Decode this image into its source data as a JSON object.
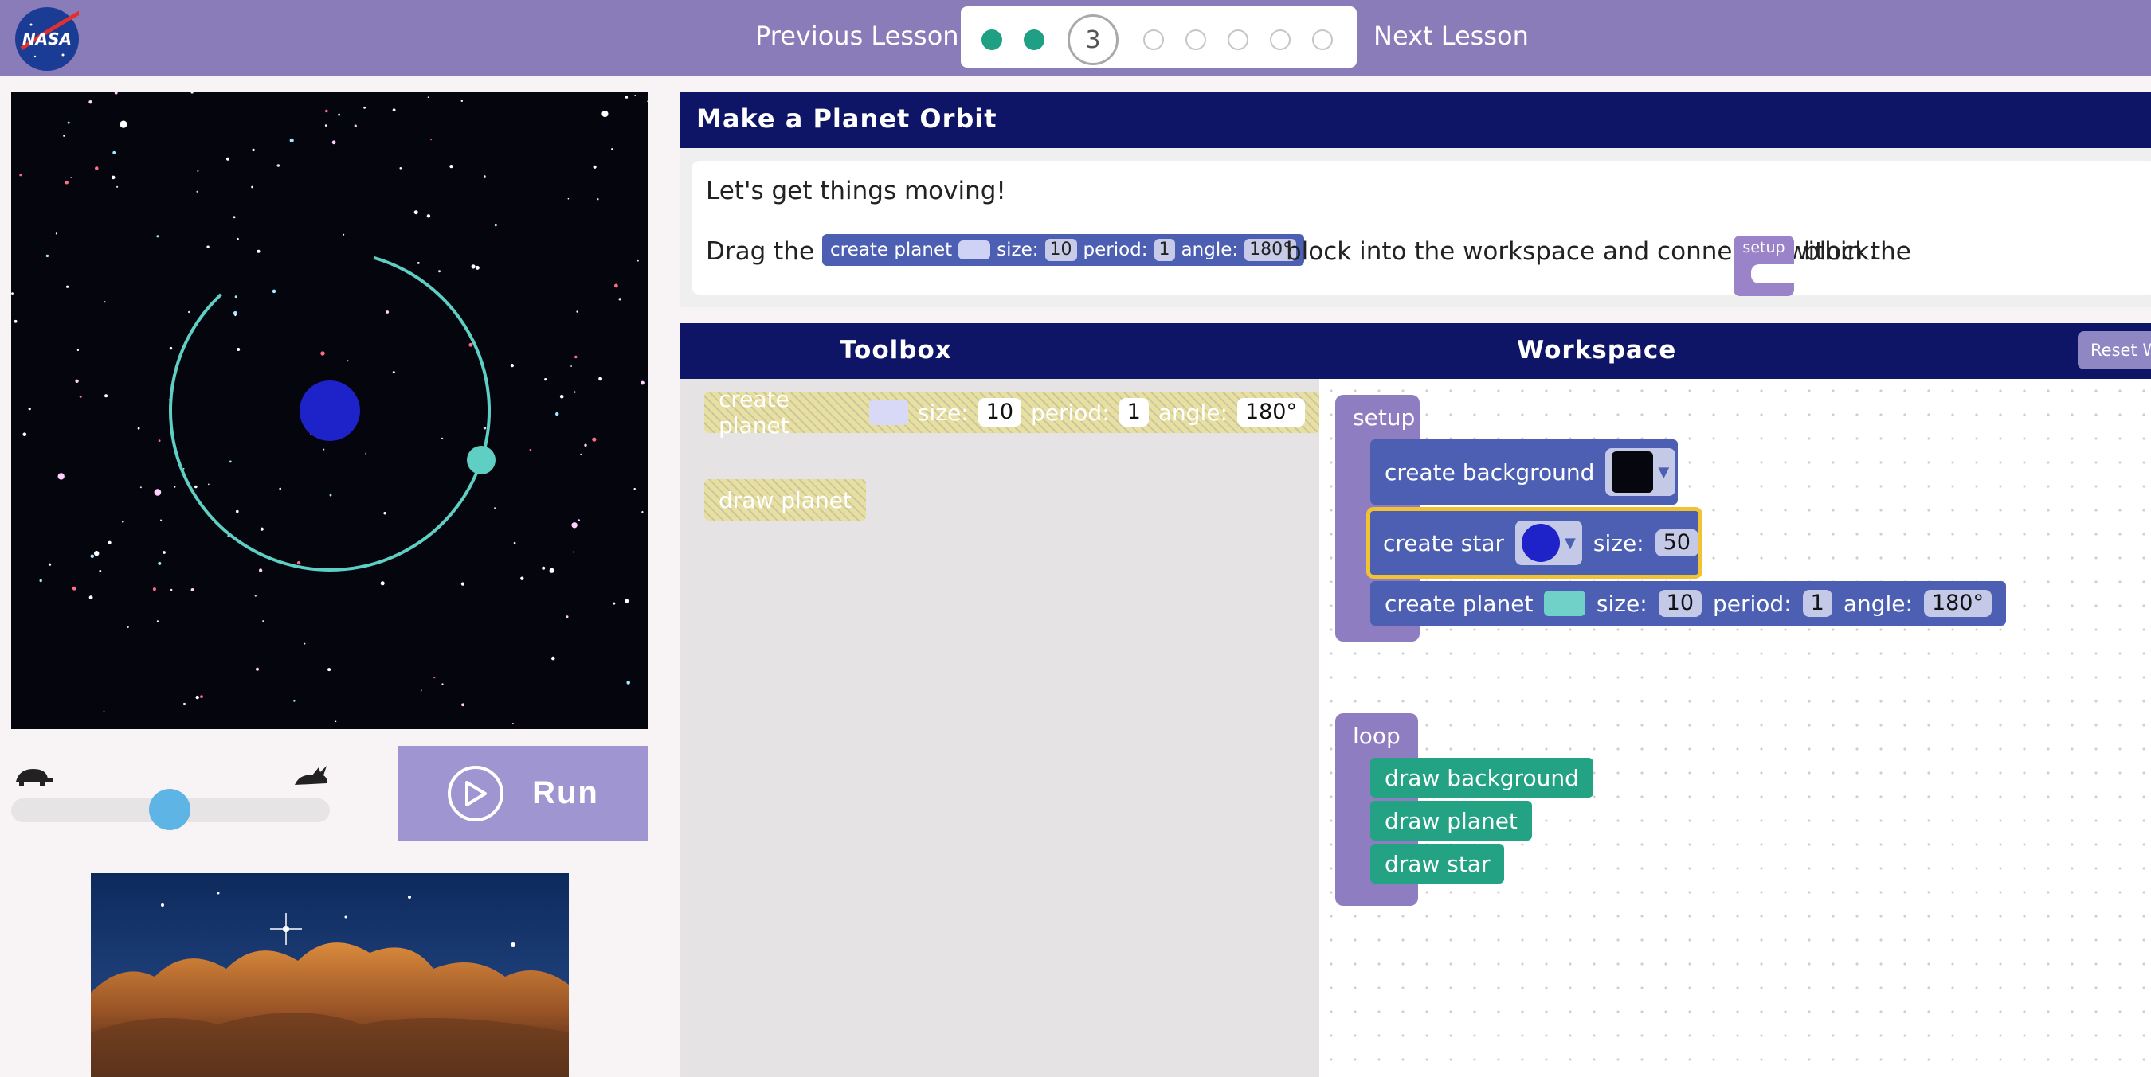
{
  "header": {
    "logo_text": "NASA",
    "previous_label": "Previous Lesson",
    "next_label": "Next Lesson",
    "progress": {
      "current": "3",
      "completed_count": 2,
      "total": 8
    }
  },
  "simulation": {
    "speed_slider_value": 0.5,
    "run_label": "Run",
    "orbit_color": "#5fcfc4",
    "star_color": "#1e22c9"
  },
  "lesson": {
    "title": "Make a Planet Orbit",
    "intro": "Let's get things moving!",
    "drag_prefix": "Drag the",
    "drag_middle": "block into the workspace and connect it within the",
    "drag_suffix": "block.",
    "inline_block": {
      "label": "create planet",
      "size_label": "size:",
      "size": "10",
      "period_label": "period:",
      "period": "1",
      "angle_label": "angle:",
      "angle": "180°"
    },
    "setup_label": "setup"
  },
  "panels": {
    "toolbox_title": "Toolbox",
    "workspace_title": "Workspace",
    "reset_label": "Reset W"
  },
  "toolbox": {
    "create_planet": {
      "label": "create planet",
      "size_label": "size:",
      "size": "10",
      "period_label": "period:",
      "period": "1",
      "angle_label": "angle:",
      "angle": "180°"
    },
    "draw_planet": "draw planet"
  },
  "workspace": {
    "setup": {
      "label": "setup",
      "create_background": "create background",
      "create_star": {
        "label": "create star",
        "size_label": "size:",
        "size": "50"
      },
      "create_planet": {
        "label": "create planet",
        "size_label": "size:",
        "size": "10",
        "period_label": "period:",
        "period": "1",
        "angle_label": "angle:",
        "angle": "180°",
        "color": "#6fd1c8"
      }
    },
    "loop": {
      "label": "loop",
      "items": [
        "draw background",
        "draw planet",
        "draw star"
      ]
    }
  },
  "colors": {
    "header": "#8a7bb9",
    "navy": "#0e1566",
    "block_blue": "#4d5fb3",
    "block_green": "#23a383",
    "event_purple": "#8f7dc2"
  }
}
